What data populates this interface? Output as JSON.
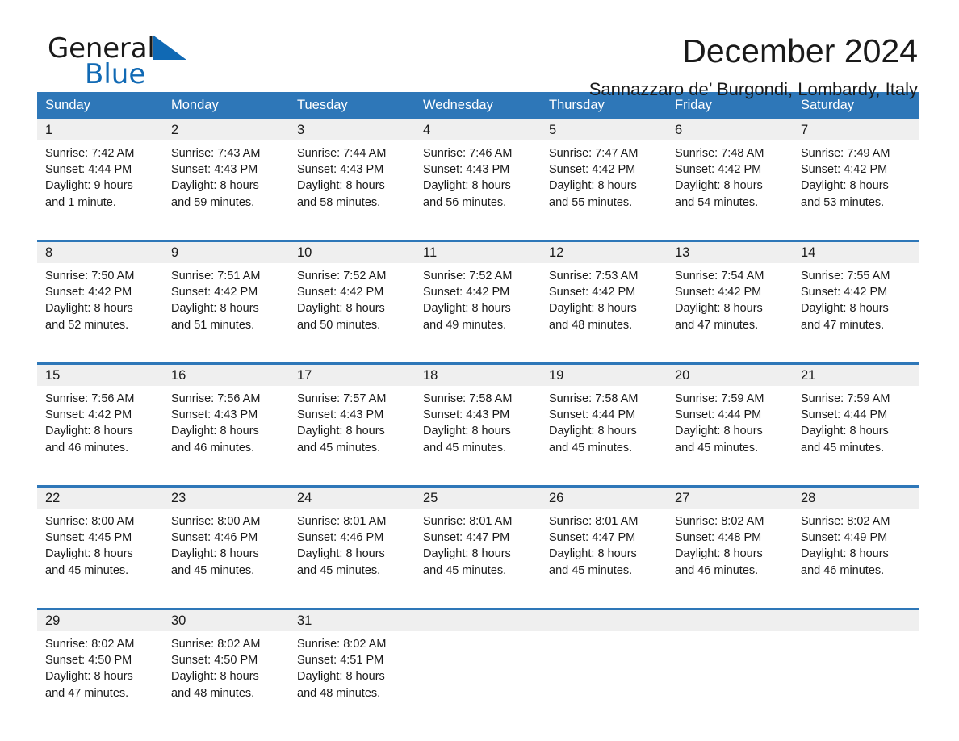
{
  "brand": {
    "name_part1": "General",
    "name_part2": "Blue",
    "accent_color": "#1069b4"
  },
  "header": {
    "title": "December 2024",
    "subtitle": "Sannazzaro de’ Burgondi, Lombardy, Italy"
  },
  "theme": {
    "header_bar_color": "#2e77b8",
    "daynum_band_color": "#efefef",
    "separator_color": "#2e77b8",
    "text_color": "#1a1a1a"
  },
  "weekday_headers": [
    "Sunday",
    "Monday",
    "Tuesday",
    "Wednesday",
    "Thursday",
    "Friday",
    "Saturday"
  ],
  "weeks": [
    [
      {
        "day": "1",
        "sunrise": "Sunrise: 7:42 AM",
        "sunset": "Sunset: 4:44 PM",
        "daylight_line1": "Daylight: 9 hours",
        "daylight_line2": "and 1 minute."
      },
      {
        "day": "2",
        "sunrise": "Sunrise: 7:43 AM",
        "sunset": "Sunset: 4:43 PM",
        "daylight_line1": "Daylight: 8 hours",
        "daylight_line2": "and 59 minutes."
      },
      {
        "day": "3",
        "sunrise": "Sunrise: 7:44 AM",
        "sunset": "Sunset: 4:43 PM",
        "daylight_line1": "Daylight: 8 hours",
        "daylight_line2": "and 58 minutes."
      },
      {
        "day": "4",
        "sunrise": "Sunrise: 7:46 AM",
        "sunset": "Sunset: 4:43 PM",
        "daylight_line1": "Daylight: 8 hours",
        "daylight_line2": "and 56 minutes."
      },
      {
        "day": "5",
        "sunrise": "Sunrise: 7:47 AM",
        "sunset": "Sunset: 4:42 PM",
        "daylight_line1": "Daylight: 8 hours",
        "daylight_line2": "and 55 minutes."
      },
      {
        "day": "6",
        "sunrise": "Sunrise: 7:48 AM",
        "sunset": "Sunset: 4:42 PM",
        "daylight_line1": "Daylight: 8 hours",
        "daylight_line2": "and 54 minutes."
      },
      {
        "day": "7",
        "sunrise": "Sunrise: 7:49 AM",
        "sunset": "Sunset: 4:42 PM",
        "daylight_line1": "Daylight: 8 hours",
        "daylight_line2": "and 53 minutes."
      }
    ],
    [
      {
        "day": "8",
        "sunrise": "Sunrise: 7:50 AM",
        "sunset": "Sunset: 4:42 PM",
        "daylight_line1": "Daylight: 8 hours",
        "daylight_line2": "and 52 minutes."
      },
      {
        "day": "9",
        "sunrise": "Sunrise: 7:51 AM",
        "sunset": "Sunset: 4:42 PM",
        "daylight_line1": "Daylight: 8 hours",
        "daylight_line2": "and 51 minutes."
      },
      {
        "day": "10",
        "sunrise": "Sunrise: 7:52 AM",
        "sunset": "Sunset: 4:42 PM",
        "daylight_line1": "Daylight: 8 hours",
        "daylight_line2": "and 50 minutes."
      },
      {
        "day": "11",
        "sunrise": "Sunrise: 7:52 AM",
        "sunset": "Sunset: 4:42 PM",
        "daylight_line1": "Daylight: 8 hours",
        "daylight_line2": "and 49 minutes."
      },
      {
        "day": "12",
        "sunrise": "Sunrise: 7:53 AM",
        "sunset": "Sunset: 4:42 PM",
        "daylight_line1": "Daylight: 8 hours",
        "daylight_line2": "and 48 minutes."
      },
      {
        "day": "13",
        "sunrise": "Sunrise: 7:54 AM",
        "sunset": "Sunset: 4:42 PM",
        "daylight_line1": "Daylight: 8 hours",
        "daylight_line2": "and 47 minutes."
      },
      {
        "day": "14",
        "sunrise": "Sunrise: 7:55 AM",
        "sunset": "Sunset: 4:42 PM",
        "daylight_line1": "Daylight: 8 hours",
        "daylight_line2": "and 47 minutes."
      }
    ],
    [
      {
        "day": "15",
        "sunrise": "Sunrise: 7:56 AM",
        "sunset": "Sunset: 4:42 PM",
        "daylight_line1": "Daylight: 8 hours",
        "daylight_line2": "and 46 minutes."
      },
      {
        "day": "16",
        "sunrise": "Sunrise: 7:56 AM",
        "sunset": "Sunset: 4:43 PM",
        "daylight_line1": "Daylight: 8 hours",
        "daylight_line2": "and 46 minutes."
      },
      {
        "day": "17",
        "sunrise": "Sunrise: 7:57 AM",
        "sunset": "Sunset: 4:43 PM",
        "daylight_line1": "Daylight: 8 hours",
        "daylight_line2": "and 45 minutes."
      },
      {
        "day": "18",
        "sunrise": "Sunrise: 7:58 AM",
        "sunset": "Sunset: 4:43 PM",
        "daylight_line1": "Daylight: 8 hours",
        "daylight_line2": "and 45 minutes."
      },
      {
        "day": "19",
        "sunrise": "Sunrise: 7:58 AM",
        "sunset": "Sunset: 4:44 PM",
        "daylight_line1": "Daylight: 8 hours",
        "daylight_line2": "and 45 minutes."
      },
      {
        "day": "20",
        "sunrise": "Sunrise: 7:59 AM",
        "sunset": "Sunset: 4:44 PM",
        "daylight_line1": "Daylight: 8 hours",
        "daylight_line2": "and 45 minutes."
      },
      {
        "day": "21",
        "sunrise": "Sunrise: 7:59 AM",
        "sunset": "Sunset: 4:44 PM",
        "daylight_line1": "Daylight: 8 hours",
        "daylight_line2": "and 45 minutes."
      }
    ],
    [
      {
        "day": "22",
        "sunrise": "Sunrise: 8:00 AM",
        "sunset": "Sunset: 4:45 PM",
        "daylight_line1": "Daylight: 8 hours",
        "daylight_line2": "and 45 minutes."
      },
      {
        "day": "23",
        "sunrise": "Sunrise: 8:00 AM",
        "sunset": "Sunset: 4:46 PM",
        "daylight_line1": "Daylight: 8 hours",
        "daylight_line2": "and 45 minutes."
      },
      {
        "day": "24",
        "sunrise": "Sunrise: 8:01 AM",
        "sunset": "Sunset: 4:46 PM",
        "daylight_line1": "Daylight: 8 hours",
        "daylight_line2": "and 45 minutes."
      },
      {
        "day": "25",
        "sunrise": "Sunrise: 8:01 AM",
        "sunset": "Sunset: 4:47 PM",
        "daylight_line1": "Daylight: 8 hours",
        "daylight_line2": "and 45 minutes."
      },
      {
        "day": "26",
        "sunrise": "Sunrise: 8:01 AM",
        "sunset": "Sunset: 4:47 PM",
        "daylight_line1": "Daylight: 8 hours",
        "daylight_line2": "and 45 minutes."
      },
      {
        "day": "27",
        "sunrise": "Sunrise: 8:02 AM",
        "sunset": "Sunset: 4:48 PM",
        "daylight_line1": "Daylight: 8 hours",
        "daylight_line2": "and 46 minutes."
      },
      {
        "day": "28",
        "sunrise": "Sunrise: 8:02 AM",
        "sunset": "Sunset: 4:49 PM",
        "daylight_line1": "Daylight: 8 hours",
        "daylight_line2": "and 46 minutes."
      }
    ],
    [
      {
        "day": "29",
        "sunrise": "Sunrise: 8:02 AM",
        "sunset": "Sunset: 4:50 PM",
        "daylight_line1": "Daylight: 8 hours",
        "daylight_line2": "and 47 minutes."
      },
      {
        "day": "30",
        "sunrise": "Sunrise: 8:02 AM",
        "sunset": "Sunset: 4:50 PM",
        "daylight_line1": "Daylight: 8 hours",
        "daylight_line2": "and 48 minutes."
      },
      {
        "day": "31",
        "sunrise": "Sunrise: 8:02 AM",
        "sunset": "Sunset: 4:51 PM",
        "daylight_line1": "Daylight: 8 hours",
        "daylight_line2": "and 48 minutes."
      },
      {
        "day": "",
        "sunrise": "",
        "sunset": "",
        "daylight_line1": "",
        "daylight_line2": ""
      },
      {
        "day": "",
        "sunrise": "",
        "sunset": "",
        "daylight_line1": "",
        "daylight_line2": ""
      },
      {
        "day": "",
        "sunrise": "",
        "sunset": "",
        "daylight_line1": "",
        "daylight_line2": ""
      },
      {
        "day": "",
        "sunrise": "",
        "sunset": "",
        "daylight_line1": "",
        "daylight_line2": ""
      }
    ]
  ]
}
